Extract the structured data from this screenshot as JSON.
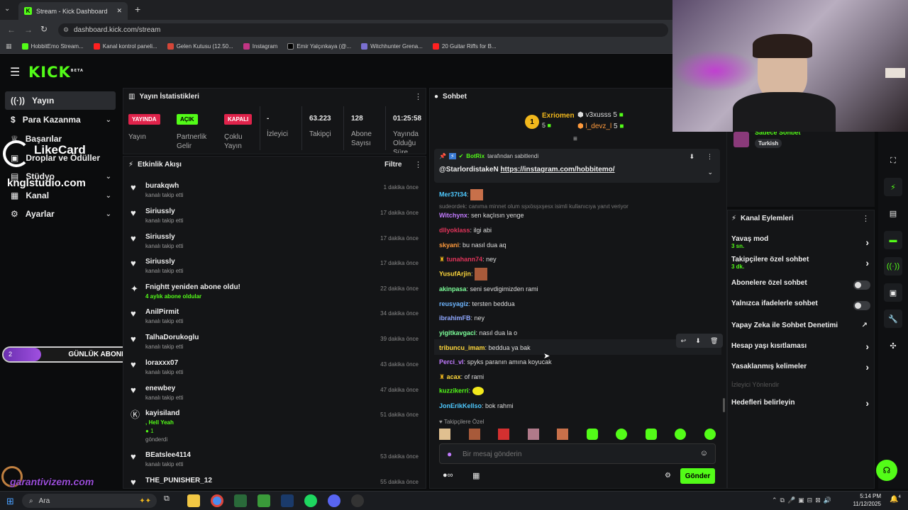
{
  "browser": {
    "tab_title": "Stream - Kick Dashboard",
    "url": "dashboard.kick.com/stream",
    "bookmarks": [
      "HobbitEmo Stream...",
      "Kanal kontrol paneli...",
      "Gelen Kutusu (12.50...",
      "Instagram",
      "Emir Yalçınkaya (@...",
      "Witchhunter Grena...",
      "20 Guitar Riffs for B..."
    ]
  },
  "brand": {
    "logo": "KICK",
    "beta": "BETA"
  },
  "sidebar": {
    "items": [
      {
        "label": "Yayın",
        "icon": "broadcast-icon"
      },
      {
        "label": "Para Kazanma",
        "icon": "dollar-icon"
      },
      {
        "label": "Başarılar",
        "icon": "trophy-icon"
      },
      {
        "label": "Droplar ve Ödüller",
        "icon": "gift-icon"
      },
      {
        "label": "Stüdyo",
        "icon": "studio-icon"
      },
      {
        "label": "Kanal",
        "icon": "channel-icon"
      },
      {
        "label": "Ayarlar",
        "icon": "gear-icon"
      }
    ]
  },
  "overlays": {
    "likecard": "LikeCard",
    "kngl": "knglstudio.com",
    "garanti": "garantivizem.com",
    "goal_label": "GÜNLÜK ABONE",
    "goal_current": "2",
    "goal_target": "10"
  },
  "stats": {
    "title": "Yayın İstatistikleri",
    "badges": [
      {
        "badge": "YAYINDA",
        "label": "Yayın"
      },
      {
        "badge": "AÇIK",
        "label": "Partnerlik Gelir"
      },
      {
        "badge": "KAPALI",
        "label": "Çoklu Yayın"
      }
    ],
    "numbers": [
      {
        "value": "-",
        "label": "İzleyici"
      },
      {
        "value": "63.223",
        "label": "Takipçi"
      },
      {
        "value": "128",
        "label": "Abone Sayısı"
      },
      {
        "value": "01:25:58",
        "label": "Yayında Olduğu Süre"
      }
    ]
  },
  "feed": {
    "title": "Etkinlik Akışı",
    "filter": "Filtre",
    "items": [
      {
        "name": "burakqwh",
        "sub": "kanalı takip etti",
        "time": "1 dakika önce"
      },
      {
        "name": "Siriussly",
        "sub": "kanalı takip etti",
        "time": "17 dakika önce"
      },
      {
        "name": "Siriussly",
        "sub": "kanalı takip etti",
        "time": "17 dakika önce"
      },
      {
        "name": "Siriussly",
        "sub": "kanalı takip etti",
        "time": "17 dakika önce"
      },
      {
        "name": "Fnightt yeniden abone oldu!",
        "sub": "4 aylık abone oldular",
        "time": "22 dakika önce"
      },
      {
        "name": "AnilPirmit",
        "sub": "kanalı takip etti",
        "time": "34 dakika önce"
      },
      {
        "name": "TalhaDorukoglu",
        "sub": "kanalı takip etti",
        "time": "39 dakika önce"
      },
      {
        "name": "loraxxx07",
        "sub": "kanalı takip etti",
        "time": "43 dakika önce"
      },
      {
        "name": "enewbey",
        "sub": "kanalı takip etti",
        "time": "47 dakika önce"
      },
      {
        "name": "kayisiland",
        "sub": ", Hell Yeah",
        "time": "51 dakika önce"
      },
      {
        "name": "BEatslee4114",
        "sub": "kanalı takip etti",
        "time": "53 dakika önce"
      },
      {
        "name": "THE_PUNISHER_12",
        "sub": "",
        "time": "55 dakika önce"
      }
    ],
    "kayisi_count": "1",
    "kayisi_sent": "gönderdi"
  },
  "chat": {
    "title": "Sohbet",
    "top_users": [
      {
        "name": "Exriomen",
        "count": "5"
      },
      {
        "name": "v3xusss",
        "count": "5"
      },
      {
        "name": "l_devz_l",
        "count": "5"
      }
    ],
    "pinned_by": "BotRix",
    "pinned_suffix": "tarafından sabitlendi",
    "pinned_msg_user": "@StarlordistakeN",
    "pinned_msg_link": "https://instagram.com/hobbitemo/",
    "reply_note": "sudeordek: canıma minnet olum sşxösşxşesx isimli kullanıcıya yanıt veriyor",
    "messages": [
      {
        "user": "Mer37t34",
        "color": "#4ec9ff",
        "text": ""
      },
      {
        "user": "Witchynx",
        "color": "#c27bff",
        "text": "sen kaçlısın yenge"
      },
      {
        "user": "dllyoklass",
        "color": "#e0345a",
        "text": "ilgi abi"
      },
      {
        "user": "skyani",
        "color": "#ff9a3c",
        "text": "bu nasıl dua aq"
      },
      {
        "user": "tunahann74",
        "color": "#e0345a",
        "text": "ney"
      },
      {
        "user": "YusufArjin",
        "color": "#ffd83c",
        "text": ""
      },
      {
        "user": "akinpasa",
        "color": "#7dff9a",
        "text": "seni sevdigimizden rami"
      },
      {
        "user": "reusyagiz",
        "color": "#6eb6ff",
        "text": "tersten beddua"
      },
      {
        "user": "ibrahimFB",
        "color": "#8fa8ff",
        "text": "ney"
      },
      {
        "user": "yigitkavgaci",
        "color": "#7dff9a",
        "text": "nasıl dua la o"
      },
      {
        "user": "tribuncu_imam",
        "color": "#ffd83c",
        "text": "beddua ya bak"
      },
      {
        "user": "Perci_vl",
        "color": "#c27bff",
        "text": "spyks paranın amına koyucak"
      },
      {
        "user": "acax",
        "color": "#ffd83c",
        "text": "of rami"
      },
      {
        "user": "kuzzikerri",
        "color": "#53fc18",
        "text": ""
      },
      {
        "user": "JonErikKellso",
        "color": "#4ec9ff",
        "text": "bok rahmi"
      }
    ],
    "followers_only": "Takipçilere Özel",
    "input_placeholder": "Bir mesaj gönderin",
    "send_label": "Gönder"
  },
  "channel": {
    "followers_only_label": "Sadece Sohbet",
    "lang": "Turkish",
    "title": "Kanal Eylemleri",
    "rows": [
      {
        "label": "Yavaş mod",
        "sub": "3 sn.",
        "control": "chevron"
      },
      {
        "label": "Takipçilere özel sohbet",
        "sub": "3 dk.",
        "control": "chevron"
      },
      {
        "label": "Abonelere özel sohbet",
        "sub": "",
        "control": "toggle"
      },
      {
        "label": "Yalnızca ifadelerle sohbet",
        "sub": "",
        "control": "toggle"
      },
      {
        "label": "Yapay Zeka ile Sohbet Denetimi",
        "sub": "",
        "control": "external"
      },
      {
        "label": "Hesap yaşı kısıtlaması",
        "sub": "",
        "control": "chevron"
      },
      {
        "label": "Yasaklanmış kelimeler",
        "sub": "",
        "control": "chevron"
      },
      {
        "label": "İzleyici Yönlendir",
        "sub": "",
        "control": "none"
      },
      {
        "label": "Hedefleri belirleyin",
        "sub": "",
        "control": "chevron"
      }
    ]
  },
  "taskbar": {
    "search": "Ara",
    "time": "5:14 PM",
    "date": "11/12/2025",
    "badge": "4"
  }
}
